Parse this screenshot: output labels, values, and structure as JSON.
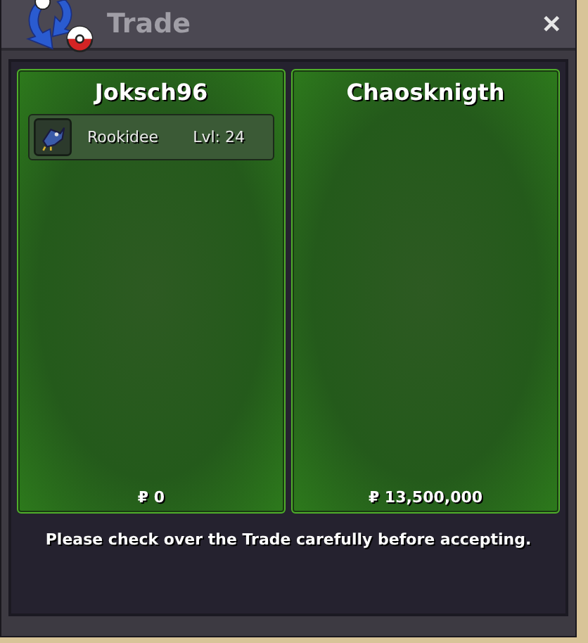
{
  "window": {
    "title": "Trade",
    "close": "✕"
  },
  "offers": [
    {
      "player": "Joksch96",
      "items": [
        {
          "name": "Rookidee",
          "level": "Lvl: 24"
        }
      ],
      "money": "₽ 0"
    },
    {
      "player": "Chaosknigth",
      "money": "₽ 13,500,000"
    }
  ],
  "message": "Please check over the Trade carefully before accepting."
}
